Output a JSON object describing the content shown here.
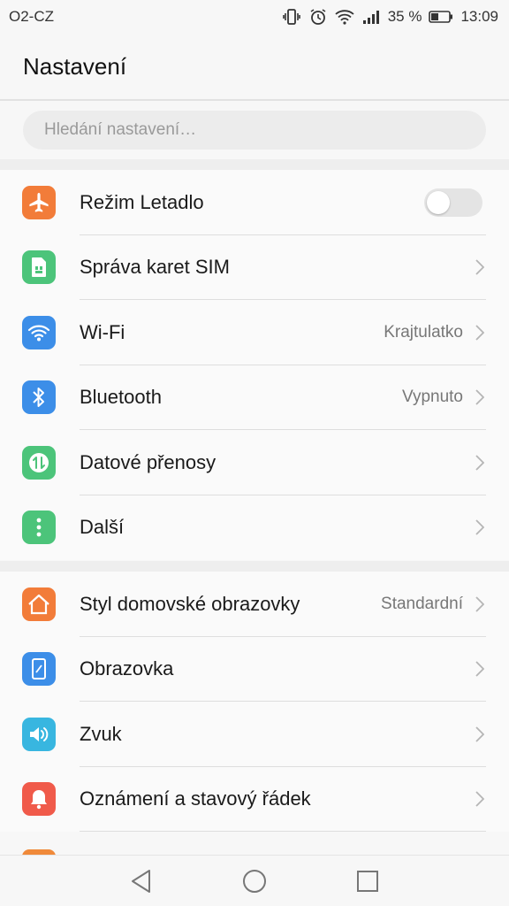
{
  "status_bar": {
    "carrier": "O2-CZ",
    "battery_percent": "35 %",
    "time": "13:09",
    "icons": [
      "vibrate-icon",
      "alarm-icon",
      "wifi-signal-icon",
      "cell-signal-icon",
      "battery-icon"
    ]
  },
  "header": {
    "title": "Nastavení"
  },
  "search": {
    "placeholder": "Hledání nastavení…"
  },
  "groups": [
    {
      "items": [
        {
          "label": "Režim Letadlo",
          "icon": "airplane-icon",
          "color": "#f27c39",
          "control": "toggle",
          "toggle_on": false
        },
        {
          "label": "Správa karet SIM",
          "icon": "sim-card-icon",
          "color": "#4cc47a",
          "control": "chevron"
        },
        {
          "label": "Wi-Fi",
          "value": "Krajtulatko",
          "icon": "wifi-icon",
          "color": "#3c8ee8",
          "control": "chevron"
        },
        {
          "label": "Bluetooth",
          "value": "Vypnuto",
          "icon": "bluetooth-icon",
          "color": "#3c8ee8",
          "control": "chevron"
        },
        {
          "label": "Datové přenosy",
          "icon": "data-transfer-icon",
          "color": "#4cc47a",
          "control": "chevron"
        },
        {
          "label": "Další",
          "icon": "more-icon",
          "color": "#4cc47a",
          "control": "chevron"
        }
      ]
    },
    {
      "items": [
        {
          "label": "Styl domovské obrazovky",
          "value": "Standardní",
          "icon": "home-icon",
          "color": "#f27c39",
          "control": "chevron"
        },
        {
          "label": "Obrazovka",
          "icon": "display-icon",
          "color": "#3c8ee8",
          "control": "chevron"
        },
        {
          "label": "Zvuk",
          "icon": "sound-icon",
          "color": "#38b6e0",
          "control": "chevron"
        },
        {
          "label": "Oznámení a stavový řádek",
          "icon": "notification-icon",
          "color": "#f05a4a",
          "control": "chevron"
        }
      ]
    }
  ],
  "nav_bar": {
    "buttons": [
      "back-icon",
      "home-circle-icon",
      "recents-icon"
    ]
  }
}
